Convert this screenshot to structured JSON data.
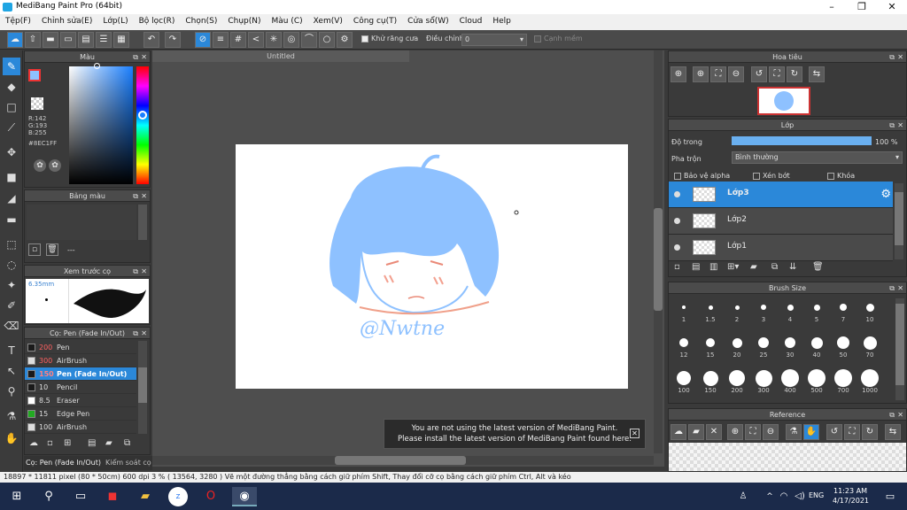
{
  "window": {
    "title": "MediBang Paint Pro (64bit)"
  },
  "menu": [
    "Tệp(F)",
    "Chỉnh sửa(E)",
    "Lớp(L)",
    "Bộ lọc(R)",
    "Chọn(S)",
    "Chụp(N)",
    "Màu (C)",
    "Xem(V)",
    "Công cụ(T)",
    "Cửa sổ(W)",
    "Cloud",
    "Help"
  ],
  "toolbar": {
    "antialias_label": "Khử răng cưa",
    "correction_label": "Điều chỉnh",
    "correction_value": "0",
    "canvas_edge_label": "Cạnh mềm"
  },
  "color_panel": {
    "title": "Màu",
    "r": "R:142",
    "g": "G:193",
    "b": "B:255",
    "hex": "#8EC1FF",
    "primary_color": "#8EC1FF"
  },
  "palette_panel": {
    "title": "Bảng màu",
    "footer": "---"
  },
  "brush_preview": {
    "title": "Xem trước cọ",
    "size": "6.35mm"
  },
  "brush_list": {
    "title": "Cọ: Pen (Fade In/Out)",
    "items": [
      {
        "size": "200",
        "name": "Pen",
        "color": "#1a1a1a",
        "size_color": "#ff6060"
      },
      {
        "size": "300",
        "name": "AirBrush",
        "color": "#dddddd",
        "size_color": "#ff6060"
      },
      {
        "size": "150",
        "name": "Pen (Fade In/Out)",
        "color": "#1a1a1a",
        "size_color": "#ff8080"
      },
      {
        "size": "10",
        "name": "Pencil",
        "color": "#1a1a1a",
        "size_color": "#dddddd"
      },
      {
        "size": "8.5",
        "name": "Eraser",
        "color": "#ffffff",
        "size_color": "#dddddd"
      },
      {
        "size": "15",
        "name": "Edge Pen",
        "color": "#22aa22",
        "size_color": "#dddddd"
      },
      {
        "size": "100",
        "name": "AirBrush",
        "color": "#dddddd",
        "size_color": "#dddddd"
      }
    ]
  },
  "left_tabs": {
    "tab1": "Cọ: Pen (Fade In/Out)",
    "tab2": "Kiểm soát cọ"
  },
  "canvas": {
    "doc_title": "Untitled",
    "signature": "@Nwtne"
  },
  "notice": {
    "line1": "You are not using the latest version of MediBang Paint.",
    "line2": "Please install the latest version of MediBang Paint found here."
  },
  "navigator": {
    "title": "Hoa tiêu"
  },
  "layers": {
    "title": "Lớp",
    "opacity_label": "Độ trong",
    "opacity_value": "100 %",
    "opacity": 1.0,
    "blend_label": "Pha trộn",
    "blend_value": "Bình thường",
    "protect_alpha": "Bảo vệ alpha",
    "clipping": "Xén bớt",
    "lock": "Khóa",
    "items": [
      "Lớp3",
      "Lớp2",
      "Lớp1"
    ]
  },
  "brush_size": {
    "title": "Brush Size",
    "sizes": [
      "1",
      "1.5",
      "2",
      "3",
      "4",
      "5",
      "7",
      "10",
      "12",
      "15",
      "20",
      "25",
      "30",
      "40",
      "50",
      "70",
      "100",
      "150",
      "200",
      "300",
      "400",
      "500",
      "700",
      "1000"
    ]
  },
  "reference": {
    "title": "Reference"
  },
  "status": {
    "text": "18897 * 11811 pixel   (80 * 50cm)  600 dpi  3 %  ( 13564, 3280 )  Vẽ một đường thẳng bằng cách giữ phím Shift, Thay đổi cỡ cọ bằng cách giữ phím Ctrl, Alt và kéo"
  },
  "taskbar": {
    "lang": "ENG",
    "time": "11:23 AM",
    "date": "4/17/2021"
  }
}
